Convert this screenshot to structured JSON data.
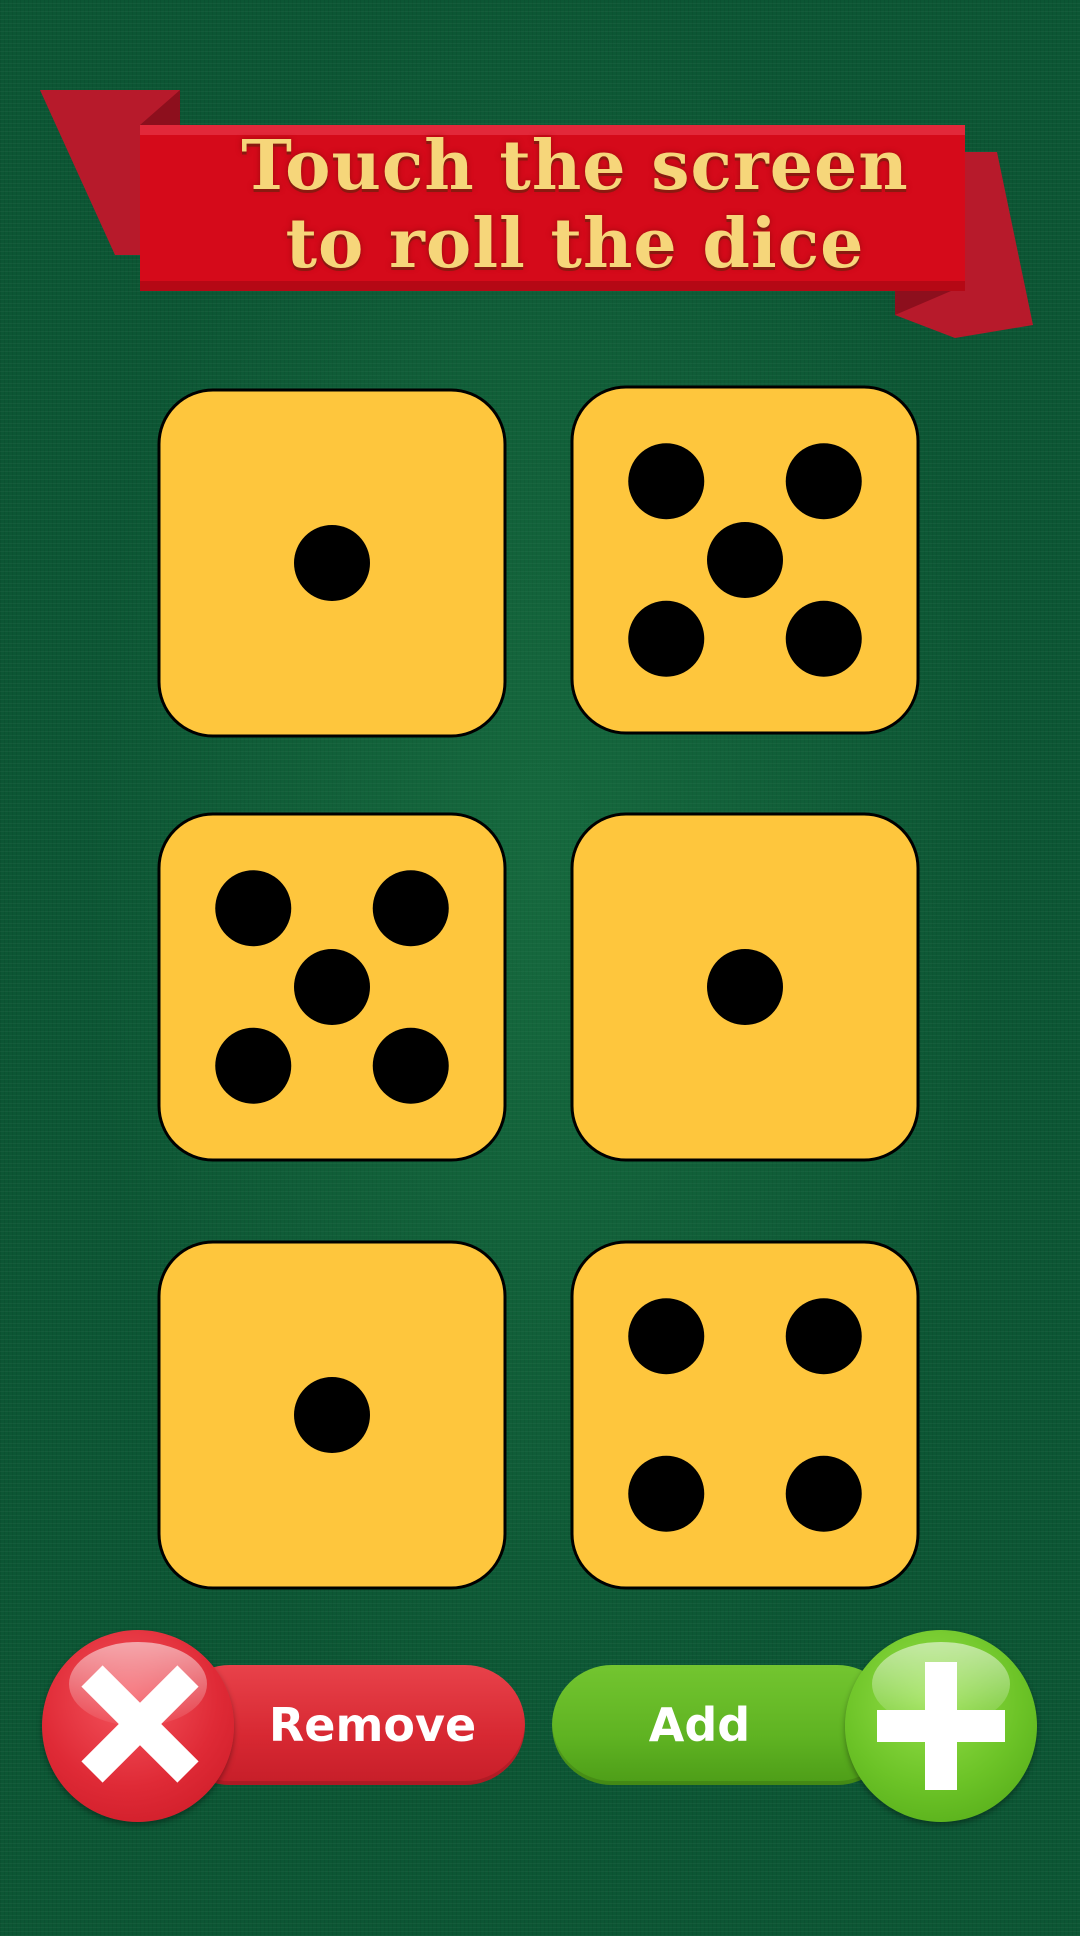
{
  "banner": {
    "line1": "Touch the screen",
    "line2": "to roll the dice"
  },
  "dice": [
    {
      "value": 1
    },
    {
      "value": 5
    },
    {
      "value": 5
    },
    {
      "value": 1
    },
    {
      "value": 1
    },
    {
      "value": 4
    }
  ],
  "buttons": {
    "remove_label": "Remove",
    "add_label": "Add"
  },
  "colors": {
    "table_felt": "#0c5634",
    "die_face": "#fec63d",
    "pip": "#000000",
    "banner_red": "#d50a1a",
    "banner_text": "#f6d67a",
    "remove_red": "#d72832",
    "add_green": "#5fb322"
  },
  "icons": {
    "remove": "close-x-icon",
    "add": "plus-icon"
  }
}
